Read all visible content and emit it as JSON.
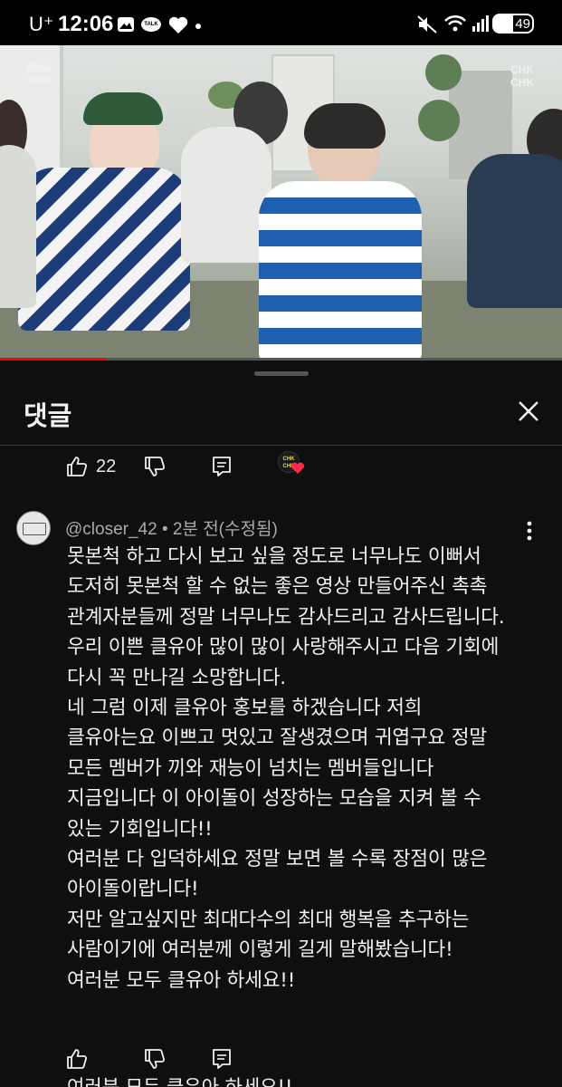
{
  "status_bar": {
    "carrier": "U⁺",
    "time": "12:06",
    "talk_label": "TALK",
    "battery": "49",
    "battery_level": 0.49
  },
  "video": {
    "watermark": "CHK\nCHK",
    "corner_logo": "Hello\nstage",
    "progress": 0.19
  },
  "comments_panel": {
    "title": "댓글",
    "prev_comment_actions": {
      "like_count": "22"
    },
    "comment": {
      "meta": "@closer_42 • 2분 전(수정됨)",
      "body": "못본척 하고 다시 보고 싶을 정도로 너무나도 이뻐서\n도저히 못본척 할 수 없는 좋은 영상 만들어주신 촉촉\n관계자분들께 정말 너무나도 감사드리고 감사드립니다.\n우리 이쁜 클유아 많이 많이 사랑해주시고 다음 기회에\n다시 꼭 만나길 소망합니다.\n네 그럼 이제 클유아 홍보를 하겠습니다 저희\n클유아는요 이쁘고 멋있고 잘생겼으며 귀엽구요 정말\n모든 멤버가 끼와 재능이 넘치는 멤버들입니다\n지금입니다 이 아이돌이 성장하는 모습을 지켜 볼 수\n있는 기회입니다!!\n여러분 다 입덕하세요 정말 보면 볼 수록 장점이 많은\n아이돌이랍니다!\n저만 알고싶지만 최대다수의 최대 행복을 추구하는\n사람이기에 여러분께 이렇게 길게 말해봤습니다!\n여러분 모두 클유아 하세요!!"
    },
    "next_comment_partial": "여러분 모두 클유아 하세요!!"
  }
}
